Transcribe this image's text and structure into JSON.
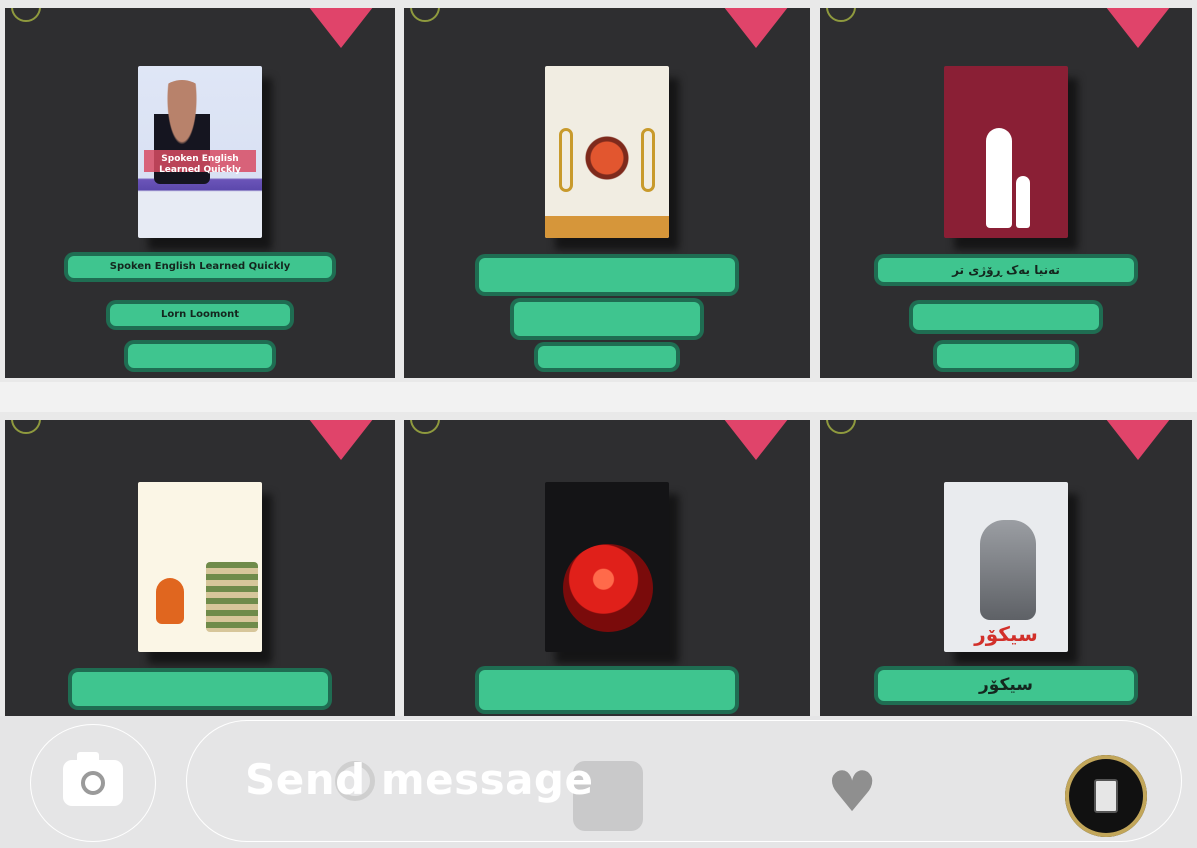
{
  "posts": [
    {
      "title_line": "Spoken English Learned Quickly",
      "author_line": "Lorn Loomont",
      "translator_line": "",
      "book_title": "Spoken English Learned Quickly"
    },
    {
      "title_line": "",
      "author_line": "",
      "translator_line": "",
      "book_title": ""
    },
    {
      "title_line": "تەنیا یەک ڕۆژی تر",
      "author_line": "",
      "translator_line": "",
      "book_title": ""
    },
    {
      "title_line": "",
      "author_line": "",
      "translator_line": "",
      "book_title": ""
    },
    {
      "title_line": "",
      "author_line": "",
      "translator_line": "",
      "book_title": ""
    },
    {
      "title_line": "سیکۆر",
      "author_line": "",
      "translator_line": "",
      "book_title": "سیکۆر"
    }
  ],
  "composer": {
    "placeholder": "Send message",
    "heart_glyph": "♥"
  },
  "icons": [
    "camera-icon",
    "heart-icon",
    "sticker-icon",
    "bookmark-ribbon-icon"
  ],
  "colors": {
    "cell_bg": "#2e2e30",
    "pill_bg": "#3fc58f",
    "ribbon": "#e0446a",
    "composer_bg": "#e5e5e6"
  }
}
